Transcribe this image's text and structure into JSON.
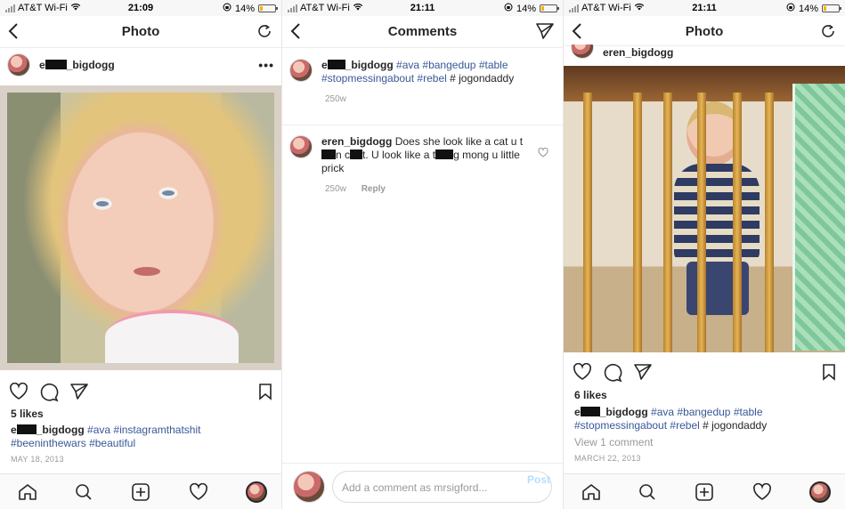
{
  "status": {
    "carrier": "AT&T Wi-Fi",
    "battery": "14%",
    "times": [
      "21:09",
      "21:11",
      "21:11"
    ]
  },
  "panel1": {
    "title": "Photo",
    "username_prefix": "e",
    "username_suffix": "_bigdogg",
    "likes": "5 likes",
    "caption_user_prefix": "e",
    "caption_user_suffix": "_bigdogg",
    "tags": [
      "#ava",
      "#instagramthatshit",
      "#beeninthewars",
      "#beautiful"
    ],
    "date": "MAY 18, 2013"
  },
  "panel2": {
    "title": "Comments",
    "comment1": {
      "user_prefix": "e",
      "user_suffix": "_bigdogg",
      "tags": [
        "#ava",
        "#bangedup",
        "#table",
        "#stopmessingabout",
        "#rebel"
      ],
      "tail": "# jogondaddy",
      "time": "250w"
    },
    "comment2": {
      "user": "eren_bigdogg",
      "text_a": "Does she look like a cat u",
      "text_b": "t",
      "text_c": "n c",
      "text_d": "t. U look like a",
      "text_e": "t",
      "text_f": "g mong u little prick",
      "time": "250w",
      "reply": "Reply"
    },
    "compose_placeholder": "Add a comment as mrsigford...",
    "post_label": "Post"
  },
  "panel3": {
    "title": "Photo",
    "username": "eren_bigdogg",
    "likes": "6 likes",
    "caption_user_prefix": "e",
    "caption_user_suffix": "_bigdogg",
    "tags": [
      "#ava",
      "#bangedup",
      "#table",
      "#stopmessingabout",
      "#rebel"
    ],
    "tail": "# jogondaddy",
    "view_comments": "View 1 comment",
    "date": "MARCH 22, 2013"
  }
}
